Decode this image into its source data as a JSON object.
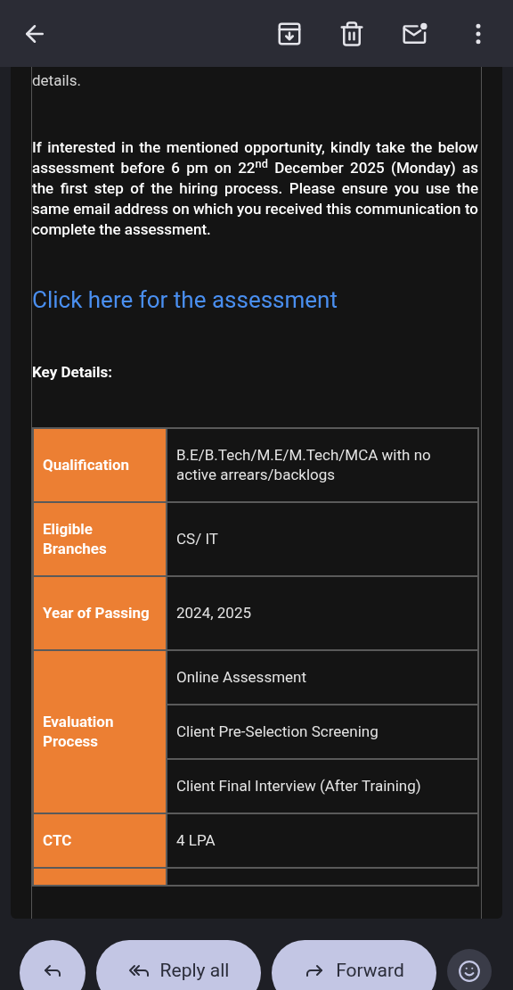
{
  "body": {
    "intro_tail": "details.",
    "paragraph": "If interested in the mentioned opportunity, kindly take the below assessment before 6 pm on 22$^{nd}$ December 2025 (Monday) as the first step of the hiring process. Please ensure you use the same email address on which you received this communication to complete the assessment.",
    "link": "Click here for the assessment",
    "heading": "Key Details:"
  },
  "table": {
    "rows": [
      {
        "label": "Qualification",
        "values": [
          "B.E/B.Tech/M.E/M.Tech/MCA with no active arrears/backlogs"
        ]
      },
      {
        "label": "Eligible Branches",
        "values": [
          "CS/ IT"
        ]
      },
      {
        "label": "Year of Passing",
        "values": [
          "2024, 2025"
        ]
      },
      {
        "label": "Evaluation Process",
        "values": [
          "Online Assessment",
          "Client Pre-Selection Screening",
          "Client Final Interview (After Training)"
        ]
      },
      {
        "label": "CTC",
        "values": [
          "4 LPA"
        ]
      }
    ]
  },
  "actions": [
    {
      "kind": "reply"
    },
    {
      "kind": "reply_all",
      "label": "Reply all"
    },
    {
      "kind": "forward",
      "label": "Forward"
    },
    {
      "kind": "emoji"
    }
  ]
}
